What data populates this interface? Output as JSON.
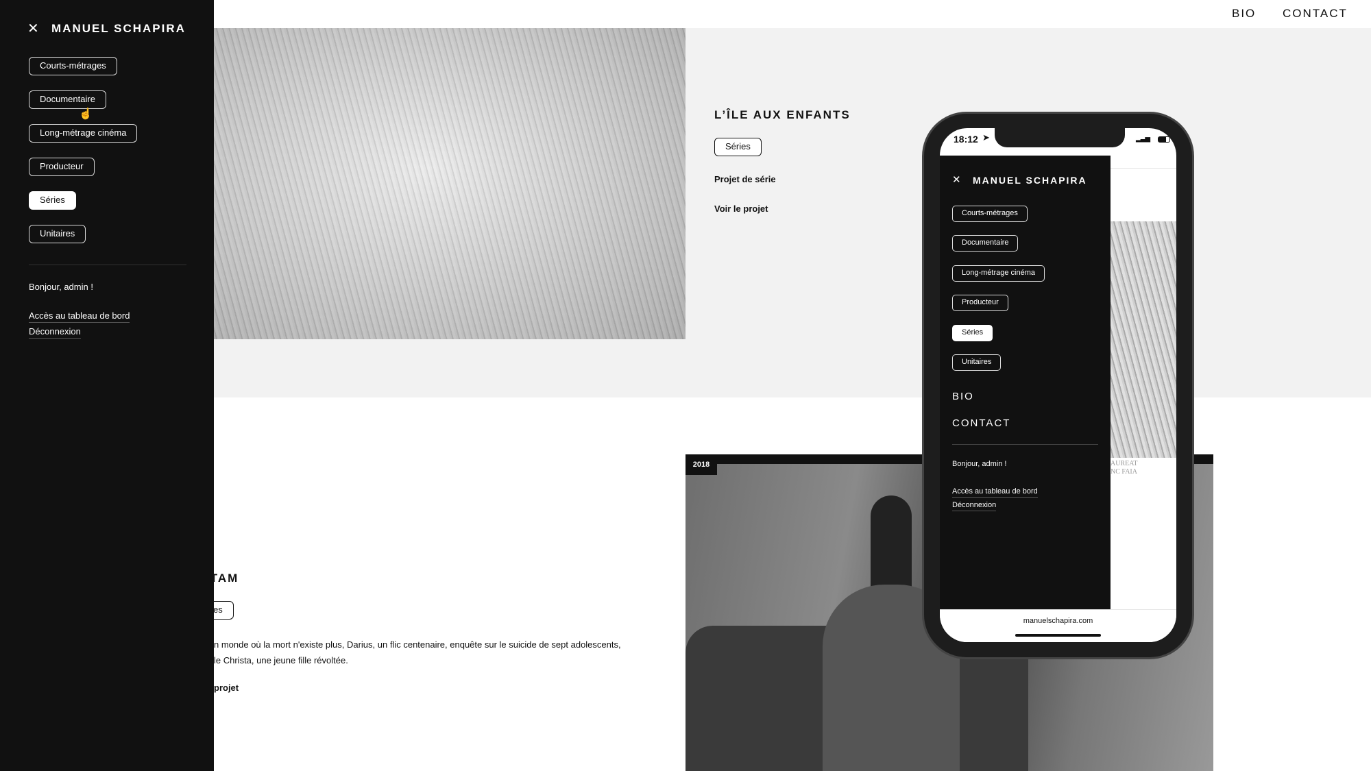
{
  "topnav": {
    "bio": "BIO",
    "contact": "CONTACT"
  },
  "sidebar": {
    "title": "MANUEL SCHAPIRA",
    "close_icon": "close-icon",
    "categories": [
      {
        "label": "Courts-métrages",
        "active": false
      },
      {
        "label": "Documentaire",
        "active": false
      },
      {
        "label": "Long-métrage cinéma",
        "active": false
      },
      {
        "label": "Producteur",
        "active": false
      },
      {
        "label": "Séries",
        "active": true
      },
      {
        "label": "Unitaires",
        "active": false
      }
    ],
    "greeting": "Bonjour, admin !",
    "dashboard_link": "Accès au tableau de bord",
    "logout_link": "Déconnexion"
  },
  "projects": [
    {
      "title": "L’ÎLE AUX ENFANTS",
      "tag": "Séries",
      "subtitle": "Projet de série",
      "link": "Voir le projet"
    },
    {
      "title": "ITAM",
      "tag": "es",
      "description_lines": [
        "n monde où la mort n'existe plus, Darius, un flic centenaire, enquête sur le suicide de sept adolescents,",
        "le Christa, une jeune fille révoltée."
      ],
      "link": "projet",
      "year": "2018"
    }
  ],
  "phone": {
    "time": "18:12",
    "title": "MANUEL SCHAPIRA",
    "categories": [
      {
        "label": "Courts-métrages",
        "active": false
      },
      {
        "label": "Documentaire",
        "active": false
      },
      {
        "label": "Long-métrage cinéma",
        "active": false
      },
      {
        "label": "Producteur",
        "active": false
      },
      {
        "label": "Séries",
        "active": true
      },
      {
        "label": "Unitaires",
        "active": false
      }
    ],
    "bio": "BIO",
    "contact": "CONTACT",
    "greeting": "Bonjour, admin !",
    "dashboard_link": "Accès au tableau de bord",
    "logout_link": "Déconnexion",
    "url": "manuelschapira.com",
    "image_caption": "AUREAT\nNC FAIA"
  }
}
